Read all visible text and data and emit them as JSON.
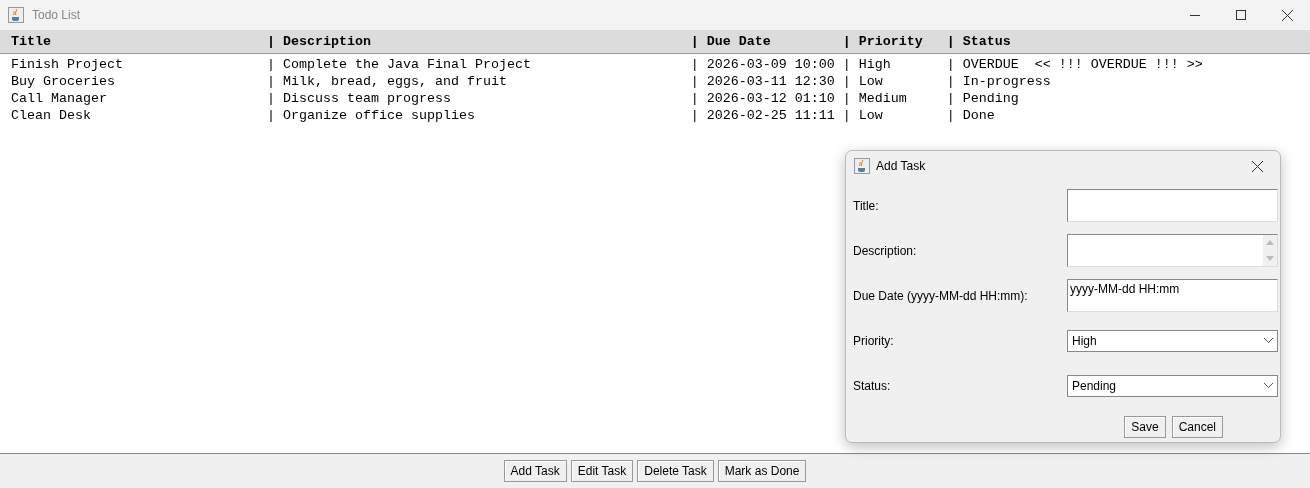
{
  "window": {
    "title": "Todo List"
  },
  "list": {
    "header": "Title                           | Description                                        | Due Date         | Priority   | Status",
    "rows": [
      "Finish Project                  | Complete the Java Final Project                    | 2026-03-09 10:00 | High       | OVERDUE  << !!! OVERDUE !!! >>",
      "Buy Groceries                   | Milk, bread, eggs, and fruit                       | 2026-03-11 12:30 | Low        | In-progress",
      "Call Manager                    | Discuss team progress                              | 2026-03-12 01:10 | Medium     | Pending",
      "Clean Desk                      | Organize office supplies                           | 2026-02-25 11:11 | Low        | Done"
    ]
  },
  "buttons": [
    "Add Task",
    "Edit Task",
    "Delete Task",
    "Mark as Done"
  ],
  "dialog": {
    "title": "Add Task",
    "fields": [
      {
        "kind": "text",
        "label": "Title:"
      },
      {
        "kind": "textarea",
        "label": "Description:"
      },
      {
        "kind": "text",
        "label": "Due Date (yyyy-MM-dd HH:mm):",
        "value": "yyyy-MM-dd HH:mm"
      },
      {
        "kind": "combo",
        "label": "Priority:",
        "value": "High"
      },
      {
        "kind": "combo",
        "label": "Status:",
        "value": "Pending"
      }
    ],
    "buttons": [
      "Save",
      "Cancel"
    ]
  }
}
